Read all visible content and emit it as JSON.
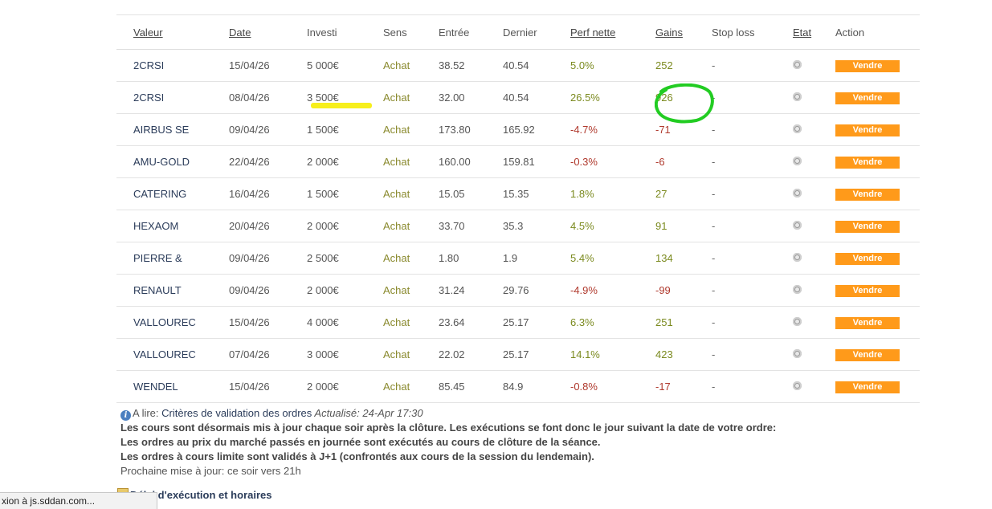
{
  "columns": {
    "valeur": "Valeur",
    "date": "Date",
    "investi": "Investi",
    "sens": "Sens",
    "entree": "Entrée",
    "dernier": "Dernier",
    "perf": "Perf nette",
    "gains": "Gains",
    "stop": "Stop loss",
    "etat": "Etat",
    "action": "Action"
  },
  "rows": [
    {
      "valeur": "2CRSI",
      "date": "15/04/26",
      "investi": "5 000€",
      "sens": "Achat",
      "entree": "38.52",
      "dernier": "40.54",
      "perf": "5.0%",
      "gains": "252",
      "stop": "-",
      "action": "Vendre",
      "trend": "pos"
    },
    {
      "valeur": "2CRSI",
      "date": "08/04/26",
      "investi": "3 500€",
      "sens": "Achat",
      "entree": "32.00",
      "dernier": "40.54",
      "perf": "26.5%",
      "gains": "926",
      "stop": "-",
      "action": "Vendre",
      "trend": "pos"
    },
    {
      "valeur": "AIRBUS SE",
      "date": "09/04/26",
      "investi": "1 500€",
      "sens": "Achat",
      "entree": "173.80",
      "dernier": "165.92",
      "perf": "-4.7%",
      "gains": "-71",
      "stop": "-",
      "action": "Vendre",
      "trend": "neg"
    },
    {
      "valeur": "AMU-GOLD",
      "date": "22/04/26",
      "investi": "2 000€",
      "sens": "Achat",
      "entree": "160.00",
      "dernier": "159.81",
      "perf": "-0.3%",
      "gains": "-6",
      "stop": "-",
      "action": "Vendre",
      "trend": "neg"
    },
    {
      "valeur": "CATERING",
      "date": "16/04/26",
      "investi": "1 500€",
      "sens": "Achat",
      "entree": "15.05",
      "dernier": "15.35",
      "perf": "1.8%",
      "gains": "27",
      "stop": "-",
      "action": "Vendre",
      "trend": "pos"
    },
    {
      "valeur": "HEXAOM",
      "date": "20/04/26",
      "investi": "2 000€",
      "sens": "Achat",
      "entree": "33.70",
      "dernier": "35.3",
      "perf": "4.5%",
      "gains": "91",
      "stop": "-",
      "action": "Vendre",
      "trend": "pos"
    },
    {
      "valeur": "PIERRE &",
      "date": "09/04/26",
      "investi": "2 500€",
      "sens": "Achat",
      "entree": "1.80",
      "dernier": "1.9",
      "perf": "5.4%",
      "gains": "134",
      "stop": "-",
      "action": "Vendre",
      "trend": "pos"
    },
    {
      "valeur": "RENAULT",
      "date": "09/04/26",
      "investi": "2 000€",
      "sens": "Achat",
      "entree": "31.24",
      "dernier": "29.76",
      "perf": "-4.9%",
      "gains": "-99",
      "stop": "-",
      "action": "Vendre",
      "trend": "neg"
    },
    {
      "valeur": "VALLOUREC",
      "date": "15/04/26",
      "investi": "4 000€",
      "sens": "Achat",
      "entree": "23.64",
      "dernier": "25.17",
      "perf": "6.3%",
      "gains": "251",
      "stop": "-",
      "action": "Vendre",
      "trend": "pos"
    },
    {
      "valeur": "VALLOUREC",
      "date": "07/04/26",
      "investi": "3 000€",
      "sens": "Achat",
      "entree": "22.02",
      "dernier": "25.17",
      "perf": "14.1%",
      "gains": "423",
      "stop": "-",
      "action": "Vendre",
      "trend": "pos"
    },
    {
      "valeur": "WENDEL",
      "date": "15/04/26",
      "investi": "2 000€",
      "sens": "Achat",
      "entree": "85.45",
      "dernier": "84.9",
      "perf": "-0.8%",
      "gains": "-17",
      "stop": "-",
      "action": "Vendre",
      "trend": "neg"
    }
  ],
  "info": {
    "prefix": "A lire: ",
    "link": "Critères de validation des ordres",
    "updated": " Actualisé: 24-Apr 17:30",
    "line1": "Les cours sont désormais mis à jour chaque soir après la clôture. Les exécutions se font donc le jour suivant la date de votre ordre:",
    "line2": "Les ordres au prix du marché passés en journée sont exécutés au cours de clôture de la séance.",
    "line3": "Les ordres à cours limite sont validés à J+1 (confrontés aux cours de la session du lendemain).",
    "next": "Prochaine mise à jour: ce soir vers 21h"
  },
  "schedule_link": "Délai d'exécution et horaires",
  "status_bar": "xion à js.sddan.com...",
  "colors": {
    "sell_button": "#ff9a1a",
    "positive": "#7b8a1f",
    "negative": "#b03a2e",
    "highlight_yellow": "#f7ef1c",
    "highlight_green": "#22cc22"
  }
}
